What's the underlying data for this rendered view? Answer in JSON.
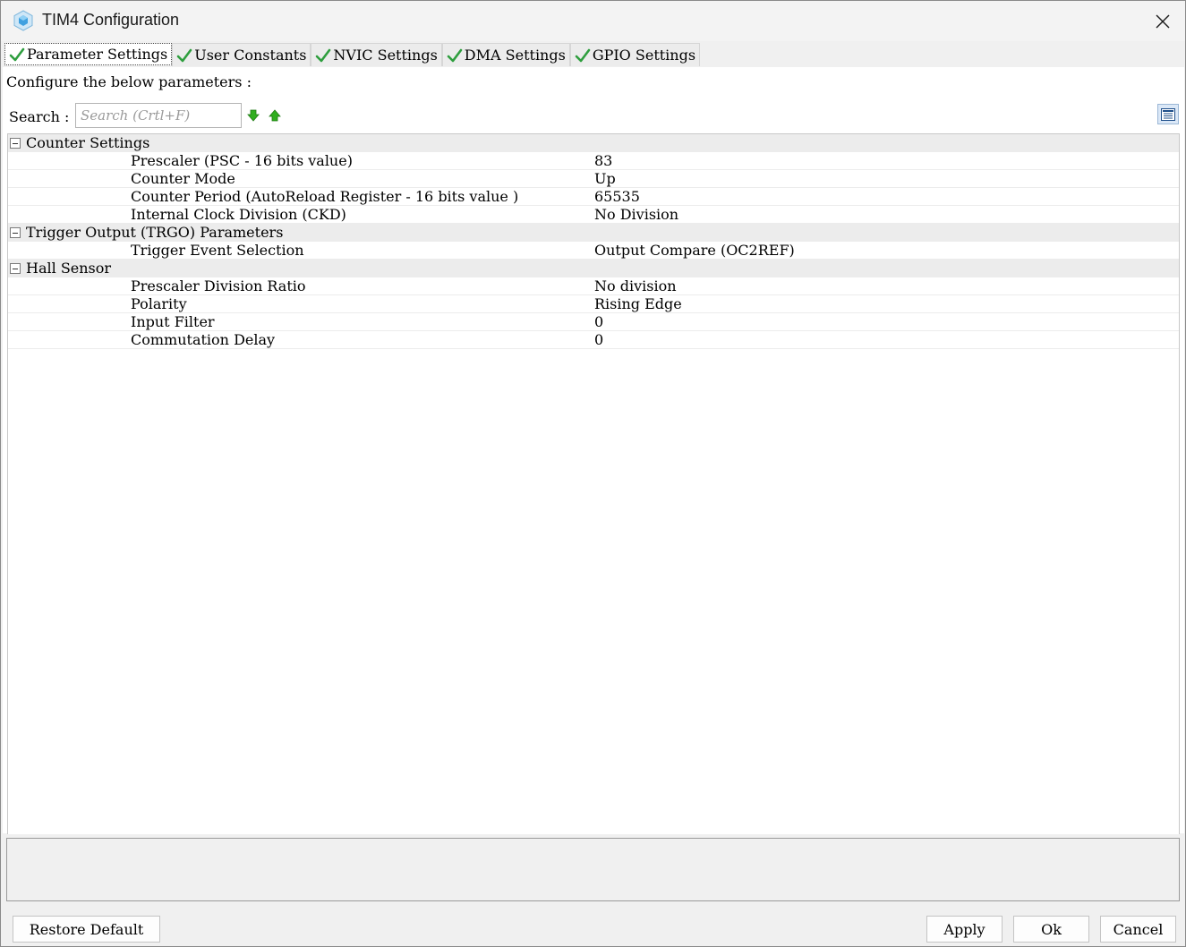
{
  "window": {
    "title": "TIM4 Configuration"
  },
  "tabs": [
    {
      "label": "Parameter Settings",
      "active": true
    },
    {
      "label": "User Constants",
      "active": false
    },
    {
      "label": "NVIC Settings",
      "active": false
    },
    {
      "label": "DMA Settings",
      "active": false
    },
    {
      "label": "GPIO Settings",
      "active": false
    }
  ],
  "main": {
    "configure_label": "Configure the below parameters :",
    "search_label": "Search :",
    "search_placeholder": "Search (Crtl+F)",
    "search_value": ""
  },
  "groups": [
    {
      "label": "Counter Settings",
      "params": [
        {
          "name": "Prescaler (PSC - 16 bits value)",
          "value": "83"
        },
        {
          "name": "Counter Mode",
          "value": "Up"
        },
        {
          "name": "Counter Period (AutoReload Register - 16 bits value )",
          "value": "65535"
        },
        {
          "name": "Internal Clock Division (CKD)",
          "value": "No Division"
        }
      ]
    },
    {
      "label": "Trigger Output (TRGO) Parameters",
      "params": [
        {
          "name": "Trigger Event Selection",
          "value": "Output Compare (OC2REF)"
        }
      ]
    },
    {
      "label": "Hall Sensor",
      "params": [
        {
          "name": "Prescaler Division Ratio",
          "value": "No division"
        },
        {
          "name": "Polarity",
          "value": "Rising Edge"
        },
        {
          "name": "Input Filter",
          "value": "0"
        },
        {
          "name": "Commutation Delay",
          "value": "0"
        }
      ]
    }
  ],
  "footer": {
    "restore_default": "Restore Default",
    "apply": "Apply",
    "ok": "Ok",
    "cancel": "Cancel"
  },
  "colors": {
    "check_green": "#2e9e3e",
    "arrow_green": "#2fae1e",
    "group_bg": "#ececec",
    "icon_blue": "#3fa0e0"
  }
}
